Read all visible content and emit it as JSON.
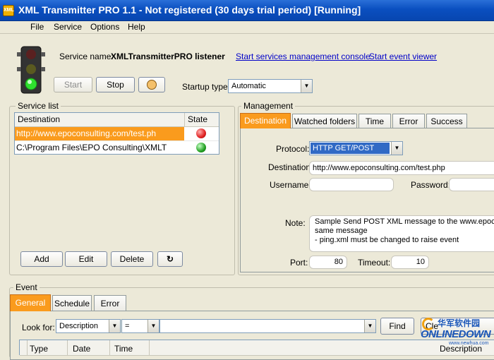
{
  "window": {
    "title": "XML Transmitter PRO 1.1 - Not registered (30 days trial period) [Running]"
  },
  "menu": [
    "File",
    "Service",
    "Options",
    "Help"
  ],
  "service": {
    "name_label": "Service name:",
    "name_value": "XMLTransmitterPRO listener",
    "links": [
      "Start services management console",
      "Start event viewer"
    ],
    "start_label": "Start",
    "stop_label": "Stop",
    "startup_label": "Startup type:",
    "startup_value": "Automatic"
  },
  "service_list": {
    "title": "Service list",
    "headers": [
      "Destination",
      "State"
    ],
    "rows": [
      {
        "destination": "http://www.epoconsulting.com/test.ph",
        "state": "stopped"
      },
      {
        "destination": "C:\\Program Files\\EPO Consulting\\XMLT",
        "state": "running"
      }
    ],
    "buttons": [
      "Add",
      "Edit",
      "Delete"
    ]
  },
  "management": {
    "title": "Management",
    "tabs": [
      "Destination",
      "Watched folders",
      "Time",
      "Error",
      "Success"
    ],
    "protocol_label": "Protocol:",
    "protocol_value": "HTTP GET/POST",
    "destination_label": "Destination",
    "destination_value": "http://www.epoconsulting.com/test.php",
    "username_label": "Username:",
    "password_label": "Password:",
    "note_label": "Note:",
    "note_lines": [
      "Sample Send POST XML message to the www.epoco",
      "same message",
      "-  ping.xml must be changed to raise event"
    ],
    "port_label": "Port:",
    "port_value": "80",
    "timeout_label": "Timeout:",
    "timeout_value": "10"
  },
  "event": {
    "title": "Event",
    "tabs": [
      "General",
      "Schedule",
      "Error"
    ],
    "look_for_label": "Look for:",
    "look_for_value": "Description",
    "operator_value": "=",
    "find_label": "Find",
    "clear_label": "Cle",
    "headers": [
      "Type",
      "Date",
      "Time",
      "Description"
    ]
  },
  "watermark": {
    "brand": "ONLINEDOWN",
    "cn": "华军软件园",
    "url": "www.newhua.com"
  },
  "colors": {
    "accent_tab": "#fa9b1d",
    "selection": "#fa9b1d",
    "title_bar": "#0a4fc0",
    "stopped": "#e02020",
    "running": "#22a022"
  }
}
